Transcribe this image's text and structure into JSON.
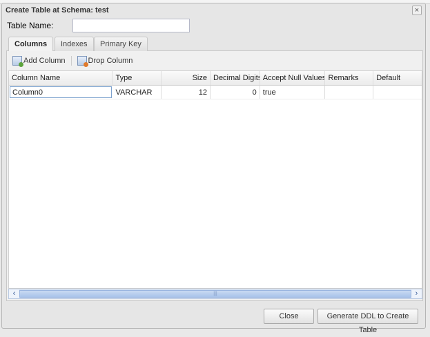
{
  "dialog": {
    "title": "Create Table at Schema: test",
    "close_icon": "×"
  },
  "table_name": {
    "label": "Table Name:",
    "value": ""
  },
  "tabs": [
    {
      "label": "Columns",
      "active": true
    },
    {
      "label": "Indexes"
    },
    {
      "label": "Primary Key"
    }
  ],
  "toolbar": {
    "add_column": "Add Column",
    "drop_column": "Drop Column"
  },
  "grid": {
    "headers": [
      "Column Name",
      "Type",
      "Size",
      "Decimal Digits",
      "Accept Null Values",
      "Remarks",
      "Default"
    ],
    "rows": [
      [
        "Column0",
        "VARCHAR",
        "12",
        "0",
        "true",
        "",
        ""
      ]
    ]
  },
  "scrollbar": {
    "left": "‹",
    "right": "›",
    "grip": "|||"
  },
  "buttons": {
    "close": "Close",
    "generate": "Generate DDL to Create Table"
  }
}
